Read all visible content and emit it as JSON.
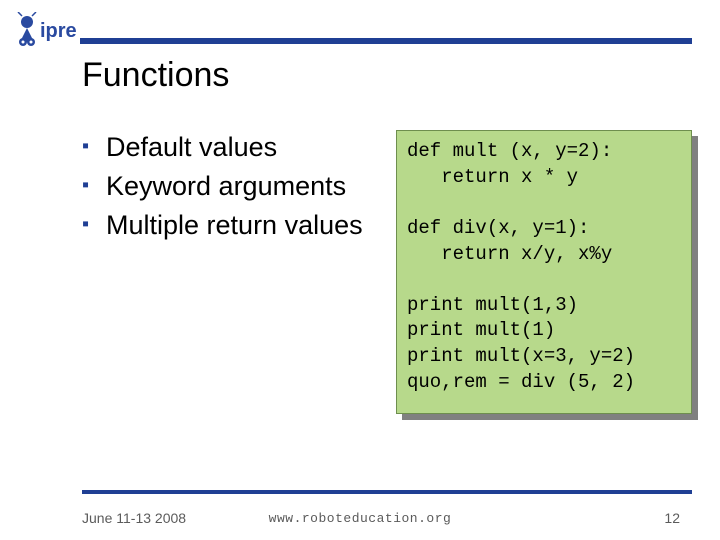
{
  "logo_text": "ipre",
  "title": "Functions",
  "bullets": [
    "Default values",
    "Keyword arguments",
    "Multiple return values"
  ],
  "code": "def mult (x, y=2):\n   return x * y\n\ndef div(x, y=1):\n   return x/y, x%y\n\nprint mult(1,3)\nprint mult(1)\nprint mult(x=3, y=2)\nquo,rem = div (5, 2)",
  "footer": {
    "date": "June 11-13 2008",
    "url": "www.roboteducation.org",
    "page": "12"
  }
}
